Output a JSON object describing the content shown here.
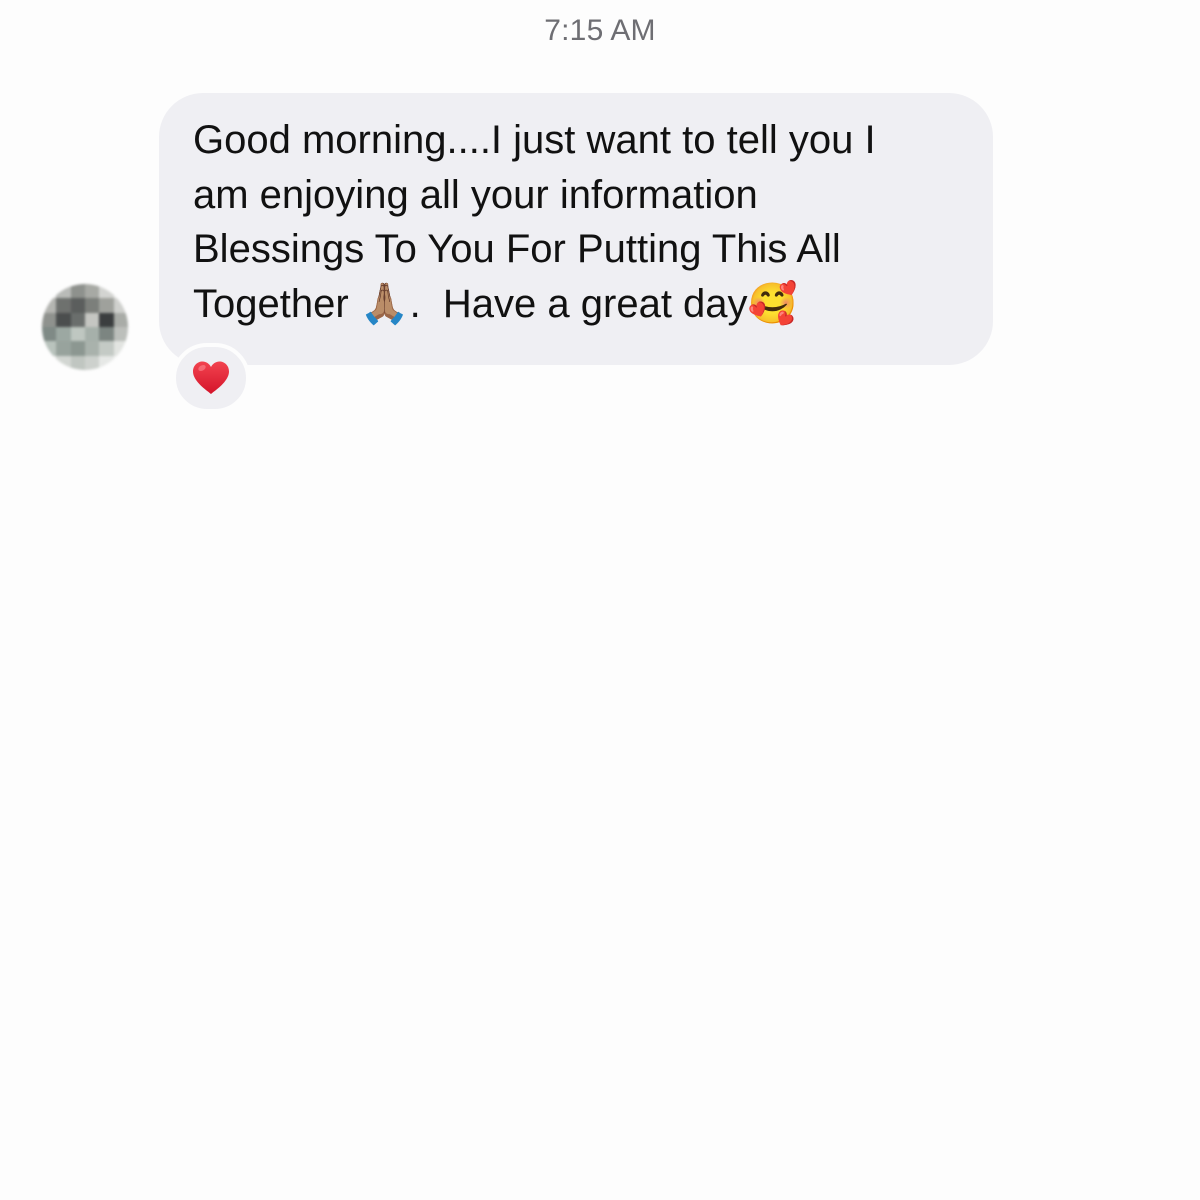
{
  "conversation": {
    "timestamp": "7:15 AM"
  },
  "message": {
    "text": "Good morning....I just want to tell you I\nam enjoying all your information\nBlessings To You For Putting This All\nTogether 🙏🏽.  Have a great day🥰",
    "reaction": "❤️",
    "bubble_color": "#efeff3"
  },
  "icons": {
    "avatar": "avatar-pixelated",
    "reaction": "heart-icon"
  },
  "colors": {
    "background": "#fdfdfd",
    "heart": "#e6293a",
    "timestamp_text": "#6e6e73"
  }
}
